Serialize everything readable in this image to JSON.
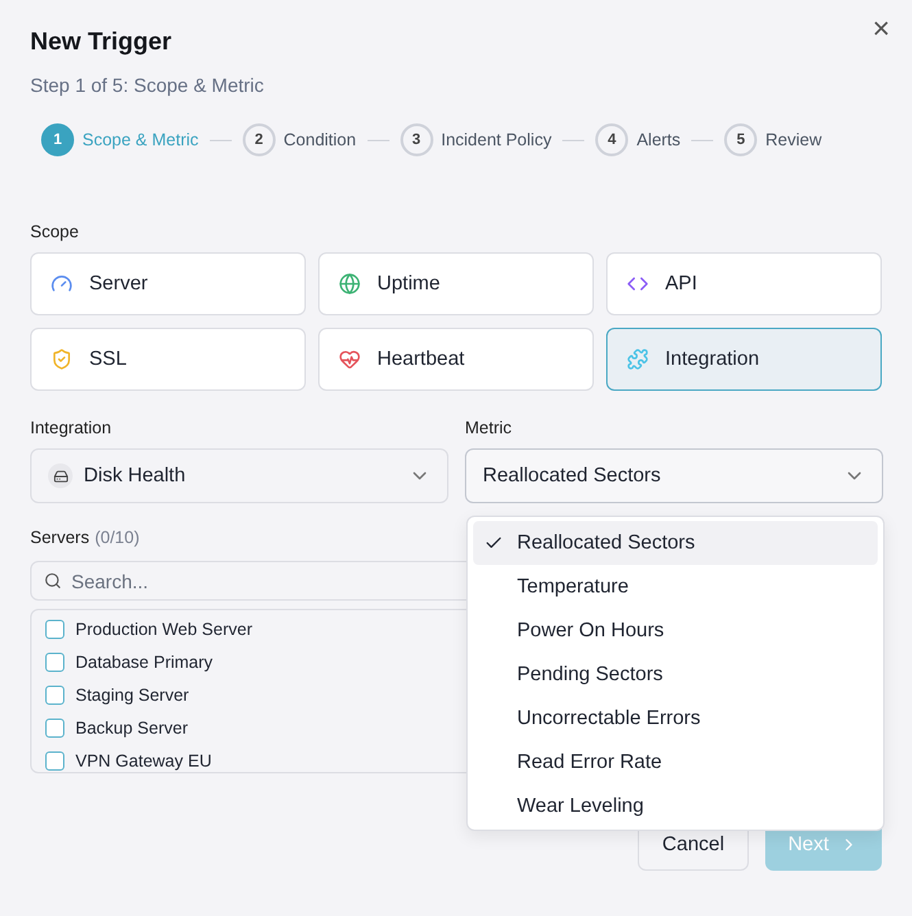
{
  "dialog": {
    "title": "New Trigger",
    "subtitle": "Step 1 of 5: Scope & Metric",
    "close": "×"
  },
  "steps": [
    {
      "number": "1",
      "label": "Scope & Metric",
      "selected": true
    },
    {
      "number": "2",
      "label": "Condition",
      "selected": false
    },
    {
      "number": "3",
      "label": "Incident Policy",
      "selected": false
    },
    {
      "number": "4",
      "label": "Alerts",
      "selected": false
    },
    {
      "number": "5",
      "label": "Review",
      "selected": false
    }
  ],
  "scope": {
    "label": "Scope",
    "options": [
      {
        "label": "Server",
        "selected": false
      },
      {
        "label": "Uptime",
        "selected": false
      },
      {
        "label": "API",
        "selected": false
      },
      {
        "label": "SSL",
        "selected": false
      },
      {
        "label": "Heartbeat",
        "selected": false
      },
      {
        "label": "Integration",
        "selected": true
      }
    ]
  },
  "integration": {
    "label": "Integration",
    "value": "Disk Health"
  },
  "metric": {
    "label": "Metric",
    "value": "Reallocated Sectors",
    "expanded": true,
    "options": [
      {
        "label": "Reallocated Sectors",
        "selected": true
      },
      {
        "label": "Temperature",
        "selected": false
      },
      {
        "label": "Power On Hours",
        "selected": false
      },
      {
        "label": "Pending Sectors",
        "selected": false
      },
      {
        "label": "Uncorrectable Errors",
        "selected": false
      },
      {
        "label": "Read Error Rate",
        "selected": false
      },
      {
        "label": "Wear Leveling",
        "selected": false
      }
    ]
  },
  "servers": {
    "label": "Servers",
    "count": "(0/10)",
    "search_placeholder": "Search...",
    "items": [
      {
        "name": "Production Web Server",
        "checked": false
      },
      {
        "name": "Database Primary",
        "checked": false
      },
      {
        "name": "Staging Server",
        "checked": false
      },
      {
        "name": "Backup Server",
        "checked": false
      },
      {
        "name": "VPN Gateway EU",
        "checked": false
      }
    ]
  },
  "buttons": {
    "cancel": "Cancel",
    "next": {
      "label": "Next",
      "disabled": true
    }
  }
}
